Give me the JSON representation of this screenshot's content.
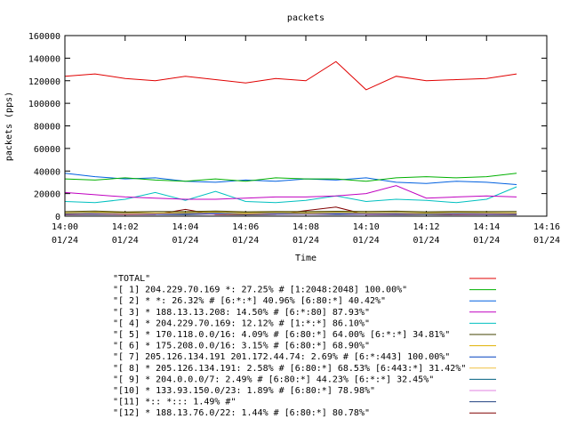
{
  "chart_data": {
    "type": "line",
    "title": "packets",
    "xlabel": "Time",
    "ylabel": "packets (pps)",
    "ylim": [
      0,
      160000
    ],
    "xlim": [
      "14:00",
      "14:16"
    ],
    "yticks": [
      "0",
      "20000",
      "40000",
      "60000",
      "80000",
      "100000",
      "120000",
      "140000",
      "160000"
    ],
    "xticks": [
      {
        "time": "14:00",
        "date": "01/24"
      },
      {
        "time": "14:02",
        "date": "01/24"
      },
      {
        "time": "14:04",
        "date": "01/24"
      },
      {
        "time": "14:06",
        "date": "01/24"
      },
      {
        "time": "14:08",
        "date": "01/24"
      },
      {
        "time": "14:10",
        "date": "01/24"
      },
      {
        "time": "14:12",
        "date": "01/24"
      },
      {
        "time": "14:14",
        "date": "01/24"
      },
      {
        "time": "14:16",
        "date": "01/24"
      }
    ],
    "x": [
      "14:00",
      "14:01",
      "14:02",
      "14:03",
      "14:04",
      "14:05",
      "14:06",
      "14:07",
      "14:08",
      "14:09",
      "14:10",
      "14:11",
      "14:12",
      "14:13",
      "14:14",
      "14:15"
    ],
    "legend_position": "bottom",
    "series": [
      {
        "name": "\"TOTAL\"",
        "color": "#e00000",
        "values": [
          124000,
          126000,
          122000,
          120000,
          124000,
          121000,
          118000,
          122000,
          120000,
          137000,
          112000,
          124000,
          120000,
          121000,
          122000,
          126000
        ]
      },
      {
        "name": "\"[ 1] 204.229.70.169 *: 27.25% # [1:2048:2048] 100.00%\"",
        "color": "#00b000",
        "values": [
          33000,
          32000,
          34000,
          32000,
          31000,
          33000,
          31000,
          34000,
          33000,
          33000,
          31000,
          34000,
          35000,
          34000,
          35000,
          38000
        ]
      },
      {
        "name": "\"[ 2] * *: 26.32% # [6:*:*] 40.96% [6:80:*] 40.42%\"",
        "color": "#0060e0",
        "values": [
          38000,
          35000,
          33000,
          34000,
          31000,
          30000,
          32000,
          31000,
          33000,
          32000,
          34000,
          30000,
          29000,
          31000,
          30000,
          28000
        ]
      },
      {
        "name": "\"[ 3] * 188.13.13.208: 14.50% # [6:*:80] 87.93%\"",
        "color": "#c000c0",
        "values": [
          21000,
          19000,
          17000,
          16000,
          15000,
          15000,
          16000,
          17000,
          17000,
          18000,
          20000,
          27000,
          16000,
          17000,
          18000,
          17000
        ]
      },
      {
        "name": "\"[ 4] * 204.229.70.169: 12.12% # [1:*:*] 86.10%\"",
        "color": "#00c0c0",
        "values": [
          13000,
          12000,
          15000,
          21000,
          14000,
          22000,
          13000,
          12000,
          14000,
          18000,
          13000,
          15000,
          14000,
          12000,
          15000,
          26000
        ]
      },
      {
        "name": "\"[ 5] * 170.118.0.0/16: 4.09% # [6:80:*] 64.00% [6:*:*] 34.81%\"",
        "color": "#404000",
        "values": [
          4000,
          4500,
          3800,
          4200,
          4000,
          4600,
          3900,
          4200,
          4000,
          4300,
          4100,
          4400,
          3900,
          4200,
          4000,
          4100
        ]
      },
      {
        "name": "\"[ 6] * 175.208.0.0/16: 3.15% # [6:80:*] 68.90%\"",
        "color": "#e0b000",
        "values": [
          3000,
          3500,
          3200,
          2800,
          3100,
          3600,
          3000,
          3300,
          2900,
          3400,
          3100,
          3200,
          3000,
          3300,
          3100,
          3000
        ]
      },
      {
        "name": "\"[ 7] 205.126.134.191 201.172.44.74: 2.69% # [6:*:443] 100.00%\"",
        "color": "#0040c0",
        "values": [
          2500,
          2800,
          3000,
          2600,
          2700,
          2500,
          2900,
          2600,
          2800,
          2400,
          2700,
          2600,
          2800,
          2500,
          2700,
          2600
        ]
      },
      {
        "name": "\"[ 8] * 205.126.134.191: 2.58% # [6:80:*] 68.53% [6:443:*] 31.42%\"",
        "color": "#f0c040",
        "values": [
          2400,
          2600,
          2300,
          2500,
          2700,
          2400,
          2200,
          2600,
          2500,
          2300,
          2600,
          2400,
          2500,
          2300,
          2600,
          2400
        ]
      },
      {
        "name": "\"[ 9] * 204.0.0.0/7: 2.49% # [6:80:*] 44.23% [6:*:*] 32.45%\"",
        "color": "#006080",
        "values": [
          2200,
          2500,
          2400,
          2600,
          2300,
          2500,
          2700,
          2400,
          2300,
          2600,
          2400,
          2500,
          2300,
          2400,
          2600,
          2300
        ]
      },
      {
        "name": "\"[10] * 133.93.150.0/23: 1.89% # [6:80:*] 78.98%\"",
        "color": "#e080e0",
        "values": [
          1800,
          2000,
          1700,
          1900,
          2200,
          1800,
          2100,
          1900,
          1700,
          2000,
          1800,
          1900,
          2100,
          1800,
          1900,
          2000
        ]
      },
      {
        "name": "\"[11] *:: *::: 1.49% #\"",
        "color": "#204080",
        "values": [
          1500,
          1400,
          1600,
          1500,
          1300,
          1700,
          1400,
          1500,
          1600,
          1400,
          1500,
          1300,
          1600,
          1500,
          1400,
          1500
        ]
      },
      {
        "name": "\"[12] * 188.13.76.0/22: 1.44% # [6:80:*] 80.78%\"",
        "color": "#800000",
        "values": [
          1200,
          1500,
          1300,
          1400,
          6000,
          1300,
          1200,
          1500,
          5000,
          8000,
          1400,
          1300,
          1500,
          1200,
          1400,
          1300
        ]
      }
    ]
  }
}
